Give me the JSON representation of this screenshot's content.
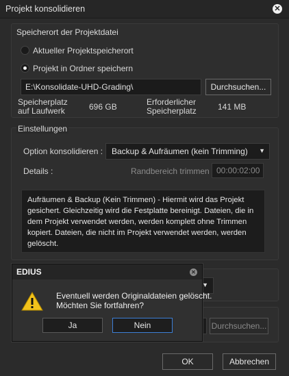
{
  "window": {
    "title": "Projekt konsolidieren",
    "close_icon": "close-icon"
  },
  "location": {
    "title": "Speicherort der Projektdatei",
    "radio_current": "Aktueller Projektspeicherort",
    "radio_folder": "Projekt in Ordner speichern",
    "path_value": "E:\\Konsolidate-UHD-Grading\\",
    "browse_label": "Durchsuchen...",
    "drive_space_label": "Speicherplatz auf Laufwerk",
    "drive_space_value": "696 GB",
    "required_label": "Erforderlicher Speicherplatz",
    "required_value": "141 MB"
  },
  "settings": {
    "title": "Einstellungen",
    "option_label": "Option konsolidieren :",
    "option_value": "Backup & Aufräumen (kein Trimming)",
    "details_label": "Details :",
    "margin_label": "Randbereich trimmen",
    "margin_value": "00:00:02:00",
    "description": "Aufräumen & Backup (Kein Trimmen) -  Hiermit wird das Projekt gesichert. Gleichzeitig wird die Festplatte bereinigt. Dateien, die in dem Projekt verwendet werden, werden komplett ohne Trimmen kopiert. Dateien, die nicht im Projekt verwendet werden, werden gelöscht."
  },
  "lower": {
    "browse_label": "Durchsuchen..."
  },
  "footer": {
    "ok_label": "OK",
    "cancel_label": "Abbrechen"
  },
  "dialog": {
    "title": "EDIUS",
    "message_line1": "Eventuell werden Originaldateien gelöscht.",
    "message_line2": "Möchten Sie fortfahren?",
    "yes_label": "Ja",
    "no_label": "Nein",
    "icon": "warning-icon"
  }
}
